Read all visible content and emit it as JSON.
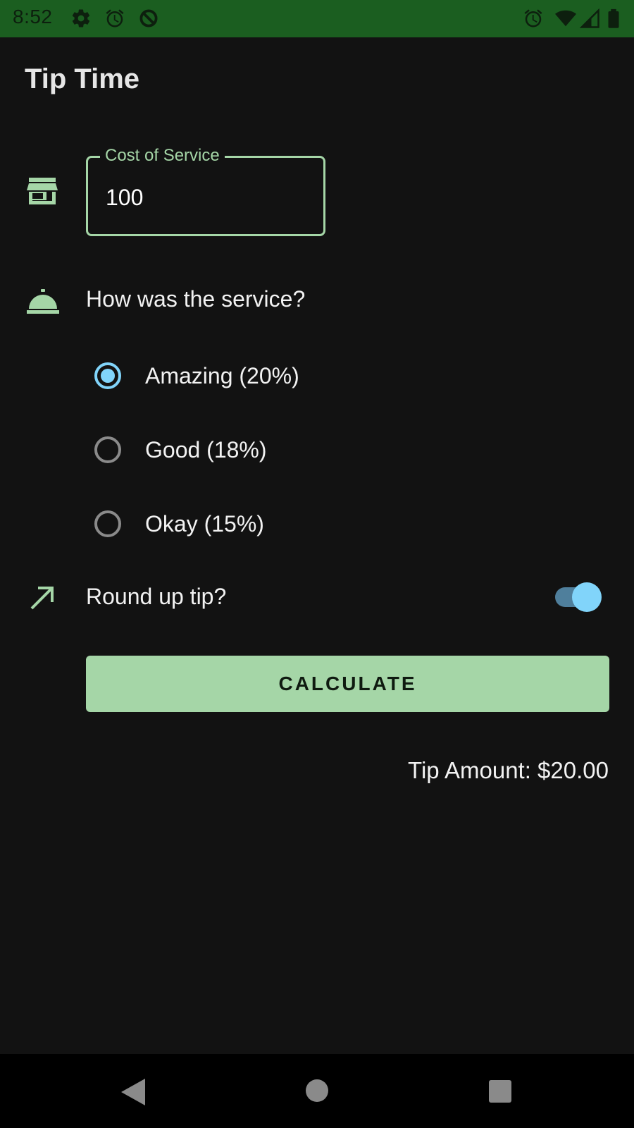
{
  "status_bar": {
    "time": "8:52",
    "icons": [
      "gear-icon",
      "alarm-icon",
      "data-saver-icon",
      "alarm-icon",
      "wifi-icon",
      "cellular-icon",
      "battery-icon"
    ]
  },
  "app": {
    "title": "Tip Time"
  },
  "cost_field": {
    "label": "Cost of Service",
    "value": "100",
    "icon": "store-icon"
  },
  "service": {
    "question": "How was the service?",
    "icon": "room-service-icon",
    "options": [
      {
        "label": "Amazing (20%)",
        "selected": true
      },
      {
        "label": "Good (18%)",
        "selected": false
      },
      {
        "label": "Okay (15%)",
        "selected": false
      }
    ]
  },
  "round_up": {
    "label": "Round up tip?",
    "icon": "trending-up-arrow-icon",
    "enabled": true
  },
  "calculate_button": {
    "label": "CALCULATE"
  },
  "result": {
    "tip_amount": "Tip Amount: $20.00"
  },
  "colors": {
    "status_bar": "#1b5e20",
    "primary": "#a5d6a7",
    "accent": "#81d4fa",
    "background": "#121212"
  }
}
